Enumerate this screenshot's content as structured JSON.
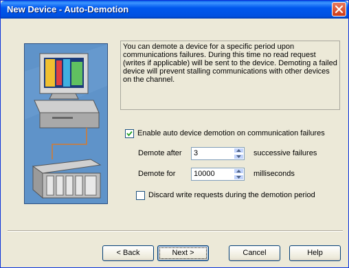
{
  "window": {
    "title": "New Device - Auto-Demotion"
  },
  "description": "You can demote a device for a specific period upon communications failures. During this time no read request (writes if applicable) will be sent to the device. Demoting a failed device will prevent stalling communications with other devices on the channel.",
  "enable_demotion": {
    "label": "Enable auto device demotion on communication failures",
    "checked": true
  },
  "demote_after": {
    "label": "Demote after",
    "value": "3",
    "units": "successive failures"
  },
  "demote_for": {
    "label": "Demote for",
    "value": "10000",
    "units": "milliseconds"
  },
  "discard_writes": {
    "label": "Discard write requests during the demotion period",
    "checked": false
  },
  "buttons": {
    "back": "< Back",
    "next": "Next >",
    "cancel": "Cancel",
    "help": "Help"
  },
  "colors": {
    "titlebar": "#0058ee",
    "dialog_bg": "#ece9d8",
    "illustration_bg": "#5b8fc6"
  }
}
